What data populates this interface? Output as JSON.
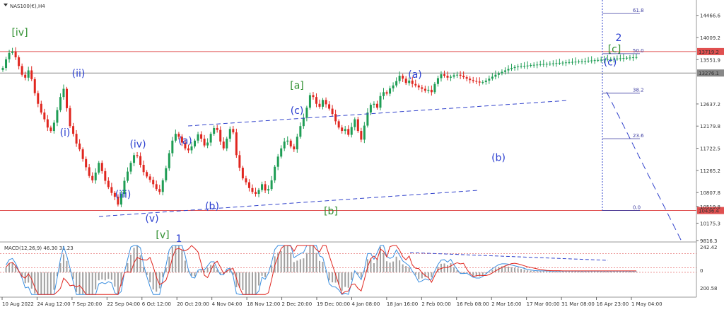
{
  "chart_data": {
    "type": "line",
    "title": "NAS100(€),H4",
    "price_axis": {
      "ylim": [
        9816.3,
        14696.4
      ],
      "ticks": [
        14466.6,
        14009.2,
        13551.9,
        13276.1,
        12637.2,
        12179.8,
        11722.5,
        11265.2,
        10807.8,
        10519.8,
        10175.3,
        9816.3
      ]
    },
    "x_ticks": [
      "10 Aug 2022",
      "24 Aug 12:00",
      "7 Sep 20:00",
      "22 Sep 04:00",
      "6 Oct 12:00",
      "20 Oct 20:00",
      "4 Nov 04:00",
      "18 Nov 12:00",
      "2 Dec 20:00",
      "19 Dec 00:00",
      "4 Jan 08:00",
      "18 Jan 16:00",
      "2 Feb 00:00",
      "16 Feb 08:00",
      "2 Mar 16:00",
      "17 Mar 00:00",
      "31 Mar 08:00",
      "16 Apr 23:00",
      "1 May 04:00"
    ],
    "series": [
      {
        "type": "candlestick",
        "x_index": [
          0,
          2,
          4,
          6,
          8,
          10,
          12,
          14,
          16,
          18,
          20,
          22,
          24,
          26,
          28,
          30,
          32,
          34,
          36,
          38,
          40,
          42,
          44,
          46,
          48,
          50,
          52,
          54,
          56,
          58,
          60,
          62,
          64,
          66,
          68,
          70,
          72,
          74,
          76,
          78,
          80,
          82,
          84,
          86,
          88,
          90,
          92,
          94,
          96,
          98,
          100,
          102,
          104,
          106,
          108,
          110,
          112,
          114,
          116,
          118,
          120,
          122,
          124,
          126,
          128,
          130,
          132,
          134,
          136,
          138,
          140,
          142,
          144,
          146,
          148,
          150,
          152,
          154,
          156,
          158,
          160,
          162,
          164,
          166,
          168,
          170,
          172,
          174,
          176,
          178,
          180,
          182,
          184,
          186,
          188,
          190,
          192,
          194,
          196,
          198,
          200,
          202,
          204,
          206,
          208,
          210,
          212,
          214,
          216,
          218,
          220,
          222,
          224,
          226,
          228,
          230,
          232,
          234,
          236,
          238,
          240,
          242,
          244,
          246,
          248,
          250,
          252,
          254,
          256,
          258,
          260,
          262,
          264,
          266,
          268,
          270,
          272,
          274,
          276,
          278,
          280,
          282,
          284,
          286,
          288,
          290,
          292,
          294,
          296,
          298,
          300,
          302,
          304,
          306,
          308,
          310,
          312,
          314,
          316,
          318,
          320,
          322,
          324,
          326,
          328,
          330,
          332,
          334,
          336,
          338,
          340,
          342,
          344,
          346,
          348,
          350,
          352,
          354,
          356,
          358,
          360,
          362,
          364,
          366,
          368,
          370,
          372,
          374,
          376,
          378,
          380,
          382,
          384,
          386,
          388,
          390,
          392,
          394,
          396,
          398
        ],
        "close": [
          13380,
          13560,
          13690,
          13720,
          13600,
          13420,
          13240,
          13180,
          13330,
          13150,
          12860,
          12640,
          12460,
          12320,
          12150,
          12080,
          12250,
          12510,
          12780,
          12950,
          12550,
          12180,
          12020,
          11820,
          11700,
          11500,
          11330,
          11150,
          11060,
          11220,
          11420,
          11250,
          11050,
          10920,
          10800,
          10720,
          10560,
          10780,
          11050,
          11240,
          11420,
          11580,
          11560,
          11380,
          11230,
          11140,
          11070,
          10980,
          10880,
          10820,
          11060,
          11310,
          11620,
          11880,
          12020,
          11960,
          11840,
          11720,
          11680,
          11760,
          11880,
          12010,
          11920,
          11780,
          11840,
          12020,
          12140,
          12100,
          11860,
          11720,
          11920,
          12120,
          12050,
          11580,
          11320,
          11100,
          11020,
          10900,
          10820,
          10780,
          10860,
          10980,
          10850,
          10880,
          11060,
          11340,
          11550,
          11720,
          11860,
          11880,
          11760,
          11700,
          11960,
          12180,
          12350,
          12560,
          12820,
          12780,
          12640,
          12580,
          12720,
          12630,
          12540,
          12430,
          12280,
          12150,
          12080,
          12120,
          12000,
          12160,
          12320,
          12080,
          11900,
          12190,
          12460,
          12620,
          12640,
          12560,
          12800,
          12880,
          12850,
          12960,
          13020,
          13110,
          13220,
          13160,
          13070,
          13120,
          13050,
          13020,
          12980,
          12950,
          12910,
          12930,
          12880,
          13050,
          13170,
          13250,
          13220,
          13180,
          13200,
          13230,
          13240,
          13220,
          13190,
          13160,
          13130,
          13110,
          13100,
          13080,
          13090,
          13120,
          13160,
          13200,
          13240,
          13270,
          13300,
          13330,
          13360,
          13380,
          13400,
          13410,
          13420,
          13425,
          13430,
          13440,
          13445,
          13450,
          13455,
          13460,
          13465,
          13470,
          13475,
          13480,
          13485,
          13490,
          13495,
          13500,
          13505,
          13510,
          13515,
          13520,
          13525,
          13530,
          13535,
          13540,
          13545,
          13550,
          13555,
          13560,
          13565,
          13570,
          13575,
          13580,
          13585,
          13590,
          13595,
          13600,
          13605
        ]
      }
    ],
    "horizontal_levels": [
      {
        "value": 13719.2,
        "label": "13719.2",
        "color": "#e05050"
      },
      {
        "value": 13276.1,
        "label": "13276.1",
        "color": "#888888"
      },
      {
        "value": 10436.4,
        "label": "10436.4",
        "color": "#e05050"
      }
    ],
    "fibonacci": [
      {
        "label": "61.8",
        "value": 14505
      },
      {
        "label": "50.0",
        "value": 13675
      },
      {
        "label": "38.2",
        "value": 12860
      },
      {
        "label": "23.6",
        "value": 11920
      },
      {
        "label": "0.0",
        "value": 10436.4
      }
    ],
    "wave_labels": [
      {
        "text": "[iv]",
        "x": 28,
        "y": 14045,
        "color": "#2f8f2f"
      },
      {
        "text": "(ii)",
        "x": 111,
        "y": 13200,
        "color": "#2a3ed0"
      },
      {
        "text": "(i)",
        "x": 92,
        "y": 11980,
        "color": "#2a3ed0"
      },
      {
        "text": "(iv)",
        "x": 195,
        "y": 11740,
        "color": "#2a3ed0"
      },
      {
        "text": "(iii)",
        "x": 174,
        "y": 10700,
        "color": "#2a3ed0"
      },
      {
        "text": "(v)",
        "x": 215,
        "y": 10200,
        "color": "#2a3ed0"
      },
      {
        "text": "[v]",
        "x": 230,
        "y": 9870,
        "color": "#2f8f2f"
      },
      {
        "text": "1",
        "x": 253,
        "y": 9790,
        "color": "#2a3ed0"
      },
      {
        "text": "(a)",
        "x": 262,
        "y": 11810,
        "color": "#2a3ed0"
      },
      {
        "text": "(b)",
        "x": 300,
        "y": 10460,
        "color": "#2a3ed0"
      },
      {
        "text": "[a]",
        "x": 420,
        "y": 12950,
        "color": "#2f8f2f"
      },
      {
        "text": "(c)",
        "x": 420,
        "y": 12430,
        "color": "#2a3ed0"
      },
      {
        "text": "[b]",
        "x": 468,
        "y": 10360,
        "color": "#2f8f2f"
      },
      {
        "text": "(a)",
        "x": 587,
        "y": 13180,
        "color": "#2a3ed0"
      },
      {
        "text": "(b)",
        "x": 705,
        "y": 11460,
        "color": "#2a3ed0"
      },
      {
        "text": "(c)",
        "x": 863,
        "y": 13430,
        "color": "#2a3ed0"
      },
      {
        "text": "[c]",
        "x": 869,
        "y": 13700,
        "color": "#2f8f2f"
      },
      {
        "text": "2",
        "x": 875,
        "y": 13940,
        "color": "#2a3ed0"
      }
    ]
  },
  "macd": {
    "label": "MACD(12,26,9) 46.30 31.23",
    "ticks": [
      "242.42",
      "0",
      "200.58"
    ]
  },
  "colors": {
    "bull": "#1f9d55",
    "bear": "#e0261f",
    "channel": "#3344cc",
    "resistance": "#e05050",
    "macd_line": "#3b8fe0",
    "signal_line": "#e0261f"
  },
  "price_badges": {
    "r1": "13719.2",
    "r2": "13276.1",
    "s1": "10436.4"
  }
}
